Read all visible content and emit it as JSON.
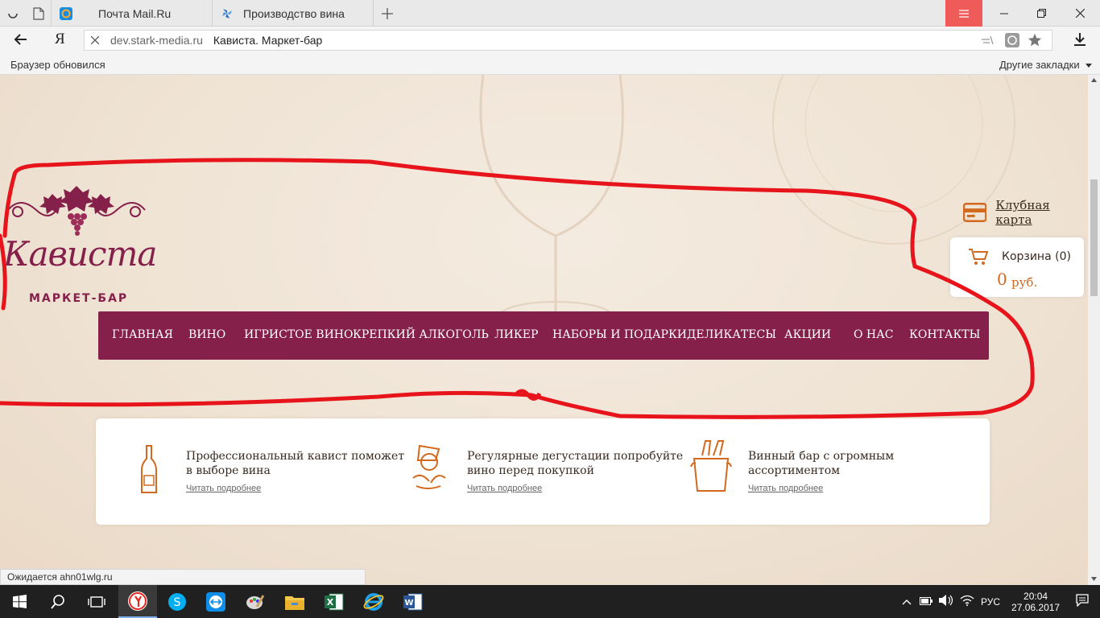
{
  "browser": {
    "tabs": [
      {
        "title": ""
      },
      {
        "title": "Почта Mail.Ru"
      },
      {
        "title": "Производство вина"
      }
    ],
    "address": {
      "domain": "dev.stark-media.ru",
      "page_title": "Кависта. Маркет-бар"
    },
    "yandex_logo": "Я",
    "bookmarks_left": "Браузер обновился",
    "bookmarks_right": "Другие закладки"
  },
  "site": {
    "logo_title": "Кависта",
    "logo_subtitle": "МАРКЕТ-БАР",
    "club_card": "Клубная карта",
    "cart_label": "Корзина (0)",
    "cart_sum": "0",
    "cart_currency": "руб.",
    "nav": [
      "ГЛАВНАЯ",
      "ВИНО",
      "ИГРИСТОЕ ВИНО",
      "КРЕПКИЙ АЛКОГОЛЬ",
      "ЛИКЕР",
      "НАБОРЫ И ПОДАРКИ",
      "ДЕЛИКАТЕСЫ",
      "АКЦИИ",
      "О НАС",
      "КОНТАКТЫ"
    ],
    "features": [
      {
        "line1": "Профессиональный кавист поможет",
        "line2": "в выборе вина",
        "link": "Читать подробнее",
        "icon": "wine-bottle-icon"
      },
      {
        "line1": "Регулярные дегустации попробуйте",
        "line2": "вино перед покупкой",
        "link": "Читать подробнее",
        "icon": "sommelier-icon"
      },
      {
        "line1": "Винный бар с огромным",
        "line2": "ассортиментом",
        "link": "Читать подробнее",
        "icon": "ice-bucket-icon"
      }
    ],
    "accent_color": "#84204a",
    "orange_color": "#d2691e"
  },
  "status_text": "Ожидается ahn01wlg.ru",
  "taskbar": {
    "lang": "РУС",
    "time": "20:04",
    "date": "27.06.2017"
  }
}
